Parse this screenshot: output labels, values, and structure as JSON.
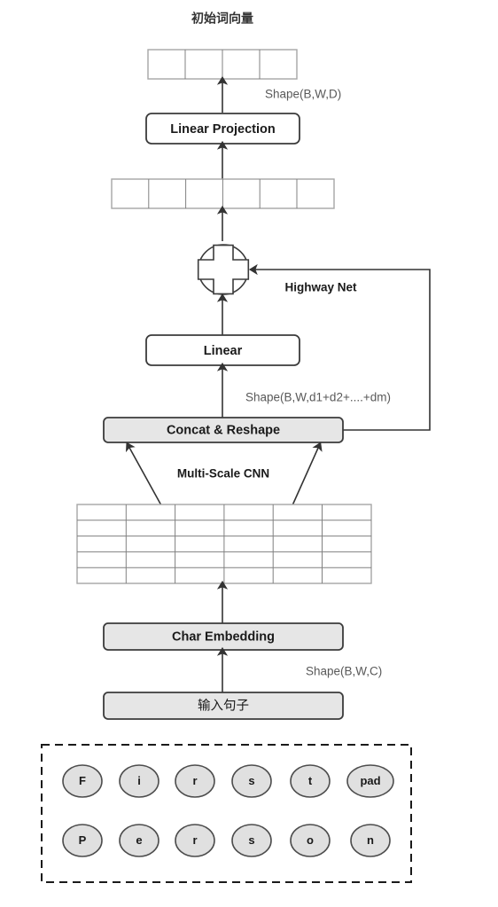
{
  "diagram": {
    "title": "初始词向量",
    "nodes": {
      "linear_projection": "Linear Projection",
      "linear": "Linear",
      "concat_reshape": "Concat & Reshape",
      "char_embedding": "Char Embedding",
      "input_sentence": "输入句子"
    },
    "annotations": {
      "highway_net": "Highway Net",
      "multi_scale_cnn": "Multi-Scale CNN"
    },
    "shape_labels": {
      "output": "Shape(B,W,D)",
      "concat": "Shape(B,W,d1+d2+....+dm)",
      "input": "Shape(B,W,C)"
    },
    "grids": {
      "word_vector_cells": 4,
      "concat_vector_cells": 6,
      "feature_map_cols": 6,
      "feature_map_rows": 5
    },
    "operators": {
      "add": "plus-circle"
    },
    "char_rows": [
      [
        "F",
        "i",
        "r",
        "s",
        "t",
        "pad"
      ],
      [
        "P",
        "e",
        "r",
        "s",
        "o",
        "n"
      ]
    ],
    "colors": {
      "box_fill_gray": "#e6e6e6",
      "box_fill_white": "#ffffff",
      "stroke_dark": "#3b3b3b",
      "text_dark": "#1a1a1a",
      "text_muted": "#595959",
      "oval_fill": "#e0e0e0",
      "background": "#ffffff"
    }
  }
}
